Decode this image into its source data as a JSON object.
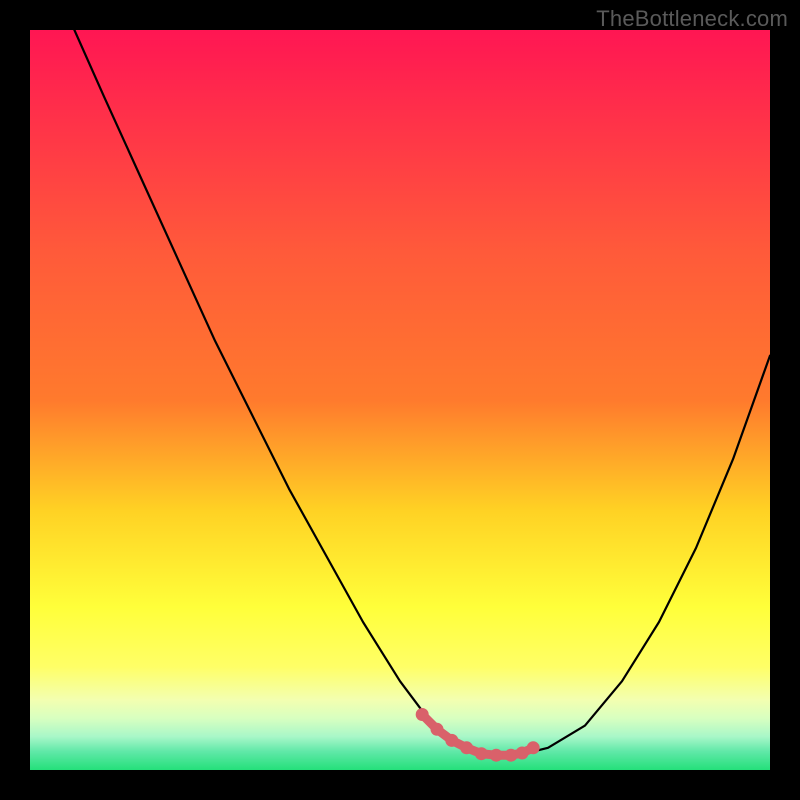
{
  "watermark": "TheBottleneck.com",
  "colors": {
    "frame": "#000000",
    "grad_top": "#ff1653",
    "grad_mid1": "#ff7a2d",
    "grad_mid2": "#ffd224",
    "grad_low1": "#ffff66",
    "grad_low2": "#f3ffb0",
    "grad_bottom": "#24e07a",
    "curve": "#000000",
    "marker": "#d9616a"
  },
  "chart_data": {
    "type": "line",
    "title": "",
    "xlabel": "",
    "ylabel": "",
    "xlim": [
      0,
      100
    ],
    "ylim": [
      0,
      100
    ],
    "series": [
      {
        "name": "bottleneck-curve",
        "x": [
          6,
          10,
          15,
          20,
          25,
          30,
          35,
          40,
          45,
          50,
          53,
          56,
          59,
          62,
          64,
          66,
          70,
          75,
          80,
          85,
          90,
          95,
          100
        ],
        "y": [
          100,
          91,
          80,
          69,
          58,
          48,
          38,
          29,
          20,
          12,
          8,
          5,
          3,
          2,
          2,
          2,
          3,
          6,
          12,
          20,
          30,
          42,
          56
        ]
      }
    ],
    "markers": {
      "name": "highlight-dots",
      "x": [
        53,
        55,
        57,
        59,
        61,
        63,
        65,
        66.5,
        68
      ],
      "y": [
        7.5,
        5.5,
        4,
        3,
        2.2,
        2,
        2,
        2.3,
        3
      ]
    }
  }
}
